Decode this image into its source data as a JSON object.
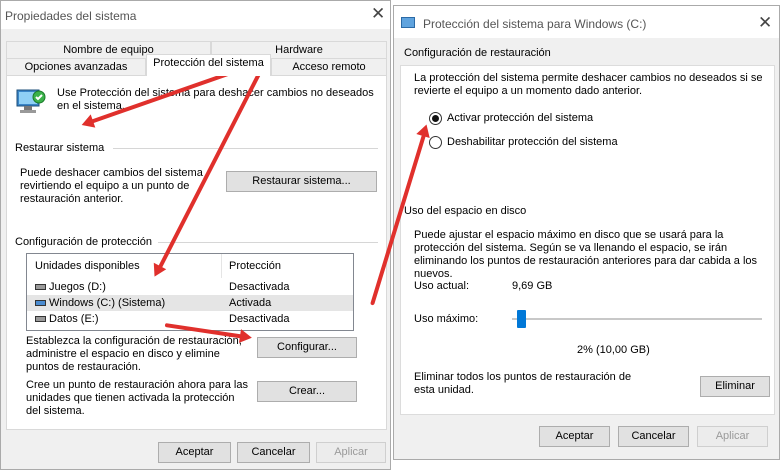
{
  "left_dialog": {
    "title": "Propiedades del sistema",
    "tabs_row1": [
      "Nombre de equipo",
      "Hardware"
    ],
    "tabs_row2": [
      "Opciones avanzadas",
      "Protección del sistema",
      "Acceso remoto"
    ],
    "intro": "Use Protección del sistema para deshacer cambios no deseados en el sistema.",
    "restore_header": "Restaurar sistema",
    "restore_desc": "Puede deshacer cambios del sistema revirtiendo el equipo a un punto de restauración anterior.",
    "restore_button": "Restaurar sistema...",
    "protection_header": "Configuración de protección",
    "drives_table": {
      "columns": [
        "Unidades disponibles",
        "Protección"
      ],
      "rows": [
        {
          "name": "Juegos (D:)",
          "status": "Desactivada"
        },
        {
          "name": "Windows (C:) (Sistema)",
          "status": "Activada"
        },
        {
          "name": "Datos (E:)",
          "status": "Desactivada"
        }
      ]
    },
    "configure_desc": "Establezca la configuración de restauración, administre el espacio en disco y elimine puntos de restauración.",
    "configure_button": "Configurar...",
    "create_desc": "Cree un punto de restauración ahora para las unidades que tienen activada la protección del sistema.",
    "create_button": "Crear...",
    "ok": "Aceptar",
    "cancel": "Cancelar",
    "apply": "Aplicar"
  },
  "right_dialog": {
    "title": "Protección del sistema para Windows (C:)",
    "restore_section": "Configuración de restauración",
    "restore_desc": "La protección del sistema permite deshacer cambios no deseados si se revierte el equipo a un momento dado anterior.",
    "radio_enable": "Activar protección del sistema",
    "radio_disable": "Deshabilitar protección del sistema",
    "enabled_selected": true,
    "disk_section": "Uso del espacio en disco",
    "disk_desc": "Puede ajustar el espacio máximo en disco que se usará para la protección del sistema. Según se va llenando el espacio, se irán eliminando los puntos de restauración anteriores para dar cabida a los nuevos.",
    "current_usage_label": "Uso actual:",
    "current_usage_value": "9,69 GB",
    "max_usage_label": "Uso máximo:",
    "max_usage_percent": 2,
    "max_usage_value": "2% (10,00 GB)",
    "delete_desc": "Eliminar todos los puntos de restauración de esta unidad.",
    "delete_button": "Eliminar",
    "ok": "Aceptar",
    "cancel": "Cancelar",
    "apply": "Aplicar"
  },
  "colors": {
    "annotation_arrow": "#e0302c",
    "slider_thumb": "#0078d7"
  },
  "icons": [
    "close-icon",
    "system-protection-icon",
    "drive-icon",
    "radio-button",
    "slider-thumb"
  ]
}
